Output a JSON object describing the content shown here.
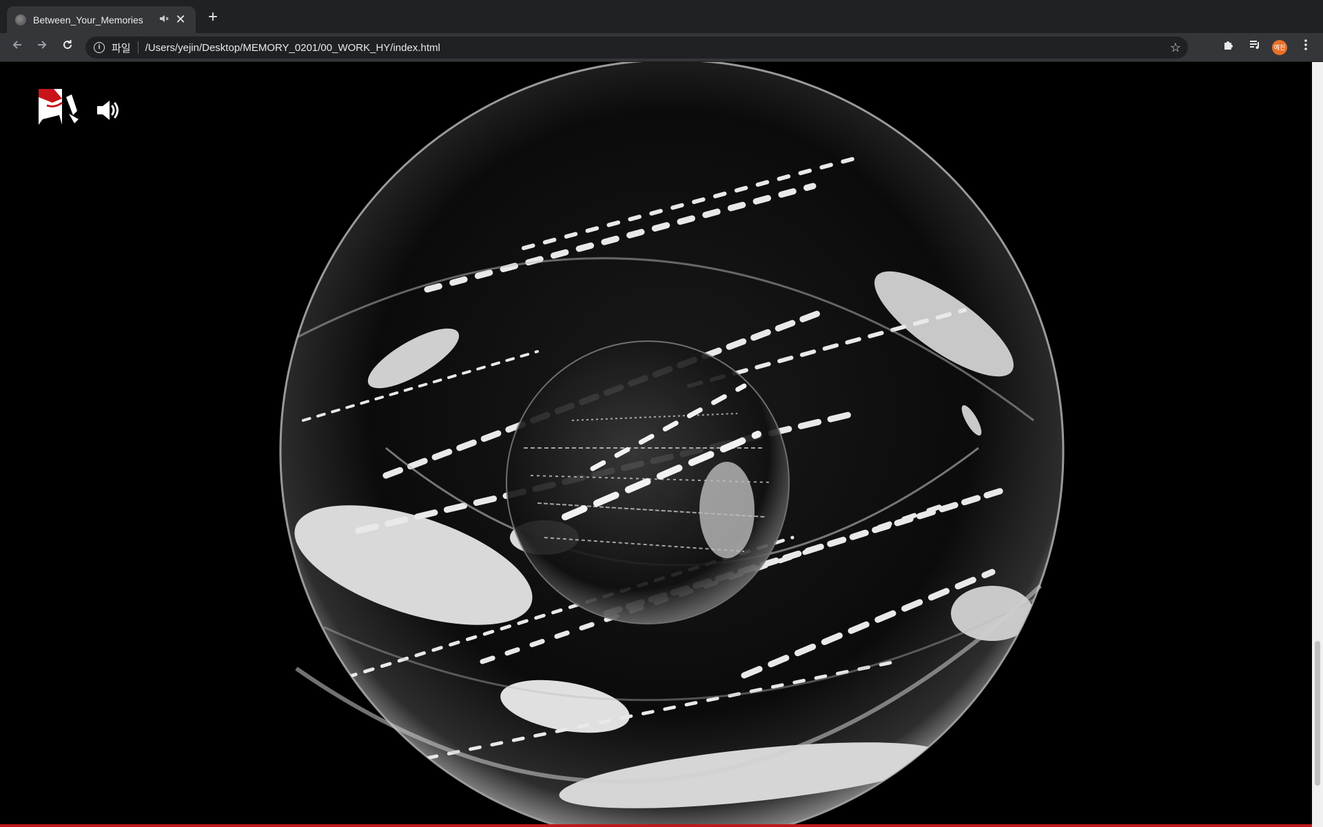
{
  "browser": {
    "tab": {
      "title": "Between_Your_Memories",
      "favicon": "globe-icon",
      "audio_icon": "speaker-muted-icon",
      "close_icon": "close-icon"
    },
    "new_tab_icon": "plus-icon",
    "toolbar": {
      "back_icon": "arrow-left-icon",
      "forward_icon": "arrow-right-icon",
      "reload_icon": "reload-icon",
      "security_icon": "info-icon",
      "scheme_label": "파일",
      "url": "/Users/yejin/Desktop/MEMORY_0201/00_WORK_HY/index.html",
      "bookmark_icon": "star-icon",
      "extensions_icon": "puzzle-icon",
      "media_icon": "playlist-icon",
      "profile_label": "예진",
      "menu_icon": "kebab-icon"
    }
  },
  "page": {
    "logo_icon": "brand-logo-icon",
    "sound_icon": "speaker-on-icon",
    "scene": "glass-sphere-with-scrambled-text",
    "colors": {
      "background": "#000000",
      "accent": "#c0171b",
      "text_on_sphere": "#e9e9e9"
    }
  }
}
